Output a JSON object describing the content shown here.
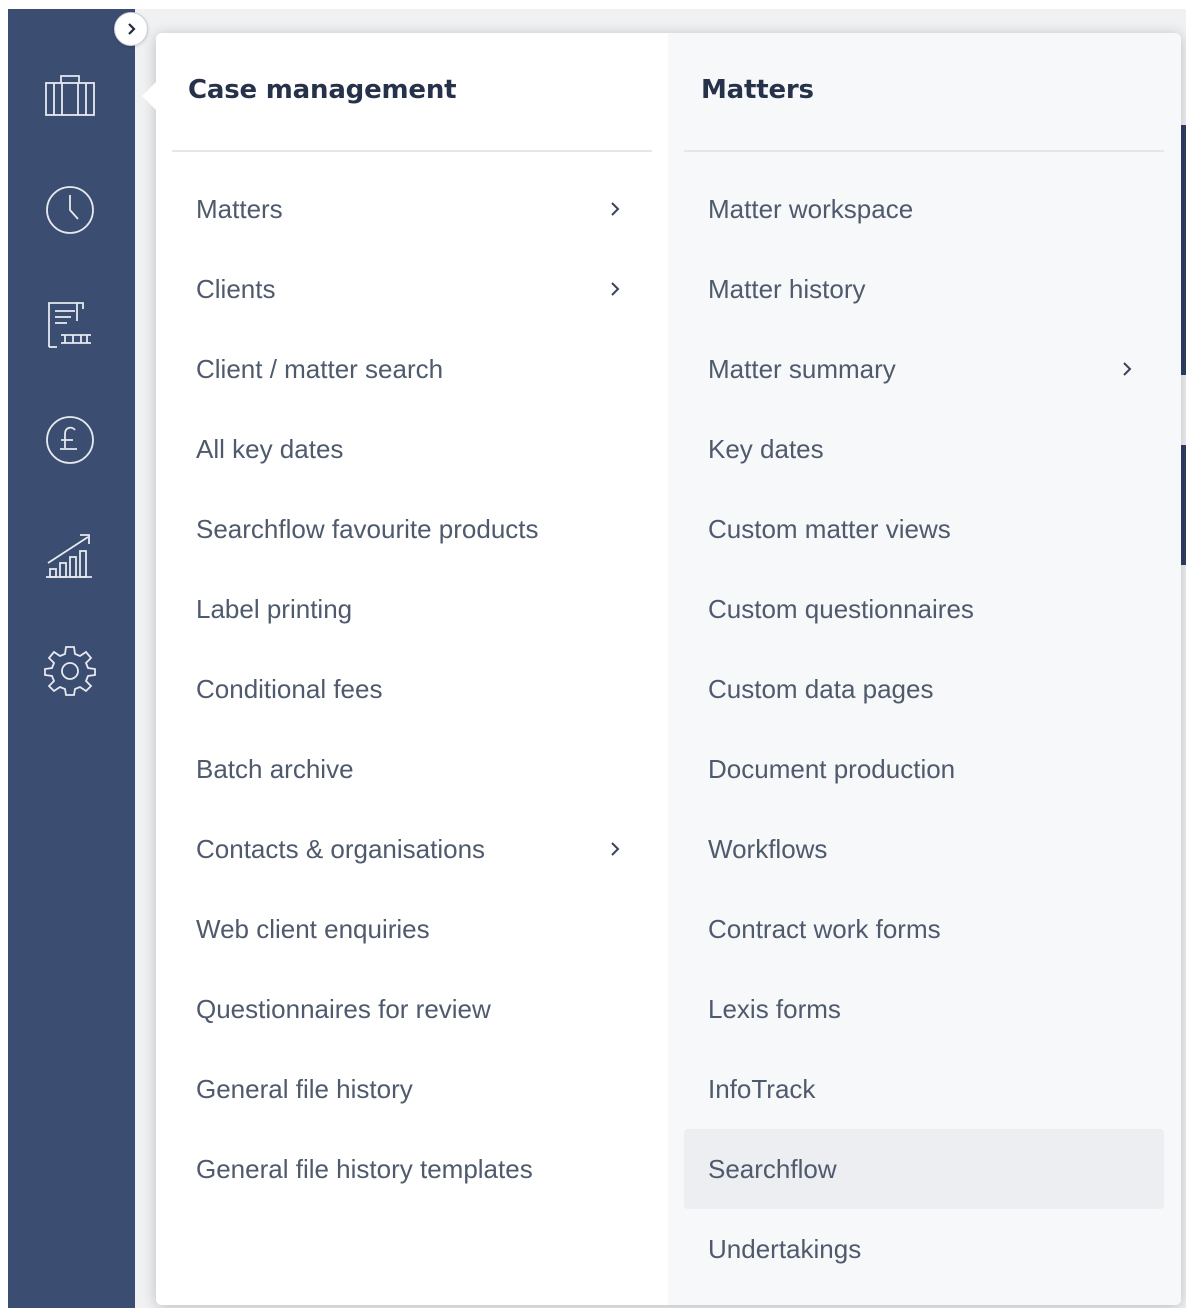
{
  "sidebar": {
    "collapse_icon": "chevron-right-icon",
    "rail_icons": [
      "briefcase-icon",
      "clock-icon",
      "document-icon",
      "pound-coin-icon",
      "chart-icon",
      "gear-icon"
    ]
  },
  "menu": {
    "left": {
      "title": "Case management",
      "items": [
        {
          "label": "Matters",
          "submenu": true
        },
        {
          "label": "Clients",
          "submenu": true
        },
        {
          "label": "Client / matter search",
          "submenu": false
        },
        {
          "label": "All key dates",
          "submenu": false
        },
        {
          "label": "Searchflow favourite products",
          "submenu": false
        },
        {
          "label": "Label printing",
          "submenu": false
        },
        {
          "label": "Conditional fees",
          "submenu": false
        },
        {
          "label": "Batch archive",
          "submenu": false
        },
        {
          "label": "Contacts & organisations",
          "submenu": true
        },
        {
          "label": "Web client enquiries",
          "submenu": false
        },
        {
          "label": "Questionnaires for review",
          "submenu": false
        },
        {
          "label": "General file history",
          "submenu": false
        },
        {
          "label": "General file history templates",
          "submenu": false
        }
      ]
    },
    "right": {
      "title": "Matters",
      "highlighted": "Searchflow",
      "items": [
        {
          "label": "Matter workspace",
          "submenu": false
        },
        {
          "label": "Matter history",
          "submenu": false
        },
        {
          "label": "Matter summary",
          "submenu": true
        },
        {
          "label": "Key dates",
          "submenu": false
        },
        {
          "label": "Custom matter views",
          "submenu": false
        },
        {
          "label": "Custom questionnaires",
          "submenu": false
        },
        {
          "label": "Custom data pages",
          "submenu": false
        },
        {
          "label": "Document production",
          "submenu": false
        },
        {
          "label": "Workflows",
          "submenu": false
        },
        {
          "label": "Contract work forms",
          "submenu": false
        },
        {
          "label": "Lexis forms",
          "submenu": false
        },
        {
          "label": "InfoTrack",
          "submenu": false
        },
        {
          "label": "Searchflow",
          "submenu": false
        },
        {
          "label": "Undertakings",
          "submenu": false
        }
      ]
    }
  }
}
